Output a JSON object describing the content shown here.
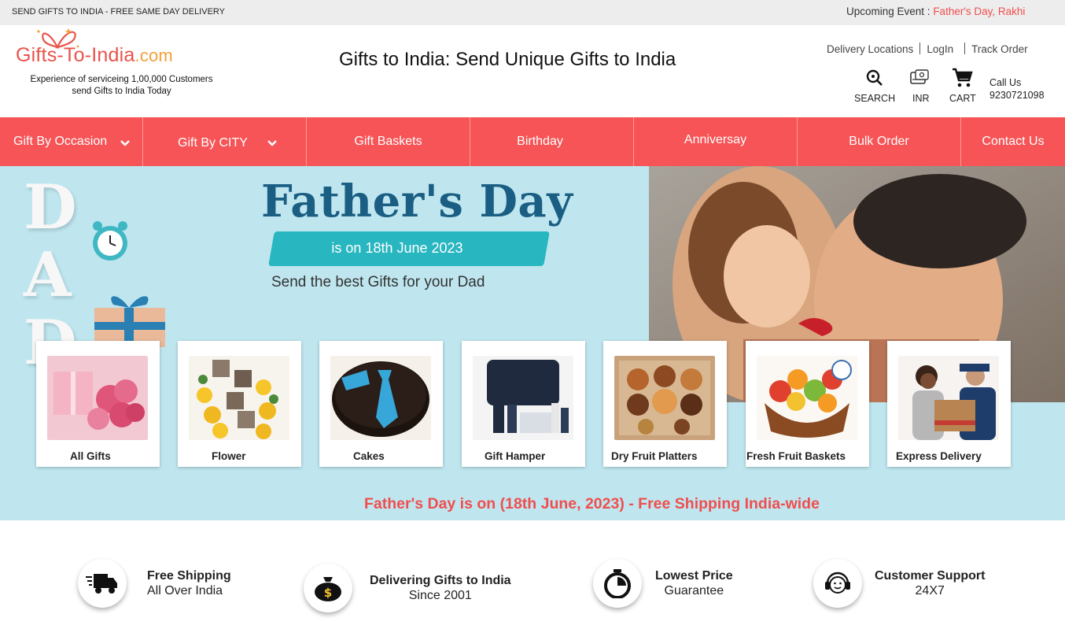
{
  "topbar": {
    "promo": "SEND GIFTS TO INDIA - FREE SAME DAY DELIVERY",
    "upcoming_label": "Upcoming Event : ",
    "upcoming_events": "Father's Day, Rakhi"
  },
  "logo": {
    "brand": "Gifts-To-India",
    "tld": ".com",
    "tagline_1": "Experience  of serviceing 1,00,000 Customers",
    "tagline_2": "send Gifts to India Today"
  },
  "header": {
    "title": "Gifts to India: Send Unique Gifts to India",
    "links": [
      "Delivery Locations",
      "LogIn",
      "Track Order"
    ],
    "search_label": "SEARCH",
    "currency_label": "INR",
    "cart_label": "CART",
    "call_label": "Call Us",
    "phone": "9230721098"
  },
  "nav": {
    "items": [
      {
        "label": "Gift By Occasion"
      },
      {
        "label": "Gift By CITY"
      },
      {
        "label": "Gift Baskets"
      },
      {
        "label": "Birthday"
      },
      {
        "label": "Anniversay"
      },
      {
        "label": "Bulk Order"
      },
      {
        "label": "Contact Us"
      }
    ]
  },
  "hero": {
    "letters": [
      "D",
      "A",
      "D"
    ],
    "title": "Father's Day",
    "date_banner": "is on 18th June 2023",
    "subtitle": "Send the best Gifts for your Dad",
    "ship_line": "Father's Day is on (18th June, 2023) - Free Shipping India-wide"
  },
  "categories": [
    {
      "label": "All Gifts"
    },
    {
      "label": "Flower"
    },
    {
      "label": "Cakes"
    },
    {
      "label": "Gift Hamper"
    },
    {
      "label": "Dry Fruit Platters"
    },
    {
      "label": "Fresh Fruit Baskets"
    },
    {
      "label": "Express Delivery"
    }
  ],
  "features": [
    {
      "title": "Free Shipping",
      "sub": "All Over India",
      "icon": "truck-icon"
    },
    {
      "title": "Delivering Gifts to India",
      "sub": "Since 2001",
      "icon": "money-bag-icon"
    },
    {
      "title": "Lowest Price",
      "sub": "Guarantee",
      "icon": "stopwatch-icon"
    },
    {
      "title": "Customer Support",
      "sub": "24X7",
      "icon": "headset-icon"
    }
  ],
  "colors": {
    "nav": "#f65456",
    "hero_bg": "#bfe6ef",
    "accent": "#f04e4e",
    "title_blue": "#1a5e83",
    "teal": "#28b6c0"
  }
}
